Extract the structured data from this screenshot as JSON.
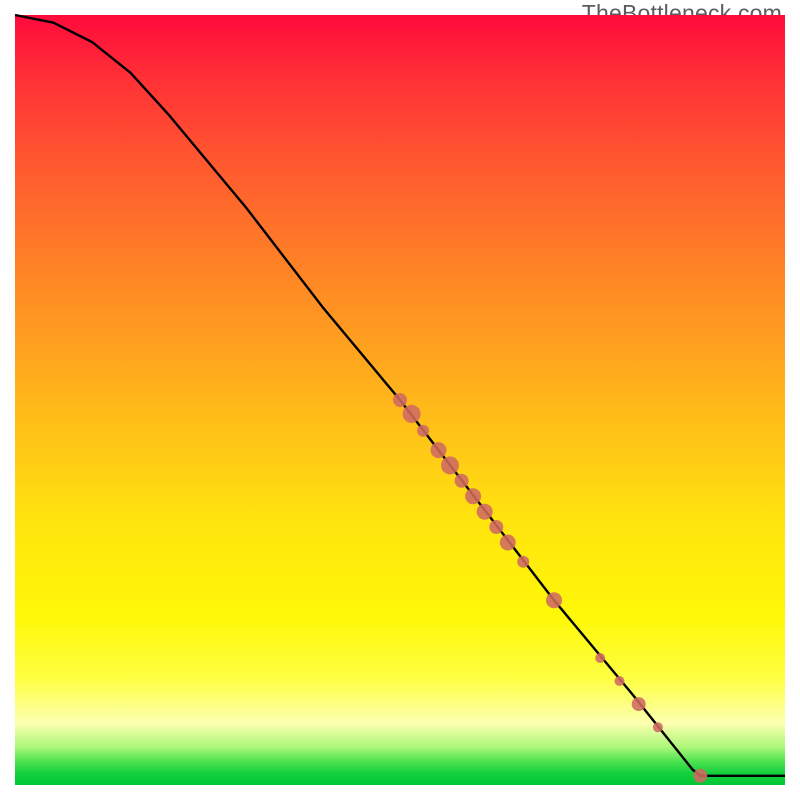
{
  "watermark": "TheBottleneck.com",
  "colors": {
    "curve_stroke": "#000000",
    "point_fill": "#cf6a61",
    "point_stroke": "#cf6a61"
  },
  "chart_data": {
    "type": "line",
    "title": "",
    "xlabel": "",
    "ylabel": "",
    "xlim": [
      0,
      100
    ],
    "ylim": [
      0,
      100
    ],
    "curve": [
      {
        "x": 0,
        "y": 100
      },
      {
        "x": 5,
        "y": 99
      },
      {
        "x": 10,
        "y": 96.5
      },
      {
        "x": 15,
        "y": 92.5
      },
      {
        "x": 20,
        "y": 87
      },
      {
        "x": 30,
        "y": 75
      },
      {
        "x": 40,
        "y": 62
      },
      {
        "x": 50,
        "y": 50
      },
      {
        "x": 60,
        "y": 37
      },
      {
        "x": 70,
        "y": 24
      },
      {
        "x": 80,
        "y": 12
      },
      {
        "x": 88,
        "y": 2
      },
      {
        "x": 89,
        "y": 1.2
      },
      {
        "x": 100,
        "y": 1.2
      }
    ],
    "points": [
      {
        "x": 50.0,
        "y": 50.0,
        "r": 7
      },
      {
        "x": 51.5,
        "y": 48.2,
        "r": 9
      },
      {
        "x": 53.0,
        "y": 46.0,
        "r": 6
      },
      {
        "x": 55.0,
        "y": 43.5,
        "r": 8
      },
      {
        "x": 56.5,
        "y": 41.5,
        "r": 9
      },
      {
        "x": 58.0,
        "y": 39.5,
        "r": 7
      },
      {
        "x": 59.5,
        "y": 37.5,
        "r": 8
      },
      {
        "x": 61.0,
        "y": 35.5,
        "r": 8
      },
      {
        "x": 62.5,
        "y": 33.5,
        "r": 7
      },
      {
        "x": 64.0,
        "y": 31.5,
        "r": 8
      },
      {
        "x": 66.0,
        "y": 29.0,
        "r": 6
      },
      {
        "x": 70.0,
        "y": 24.0,
        "r": 8
      },
      {
        "x": 76.0,
        "y": 16.5,
        "r": 5
      },
      {
        "x": 78.5,
        "y": 13.5,
        "r": 5
      },
      {
        "x": 81.0,
        "y": 10.5,
        "r": 7
      },
      {
        "x": 83.5,
        "y": 7.5,
        "r": 5
      },
      {
        "x": 89.0,
        "y": 1.2,
        "r": 7
      }
    ]
  }
}
